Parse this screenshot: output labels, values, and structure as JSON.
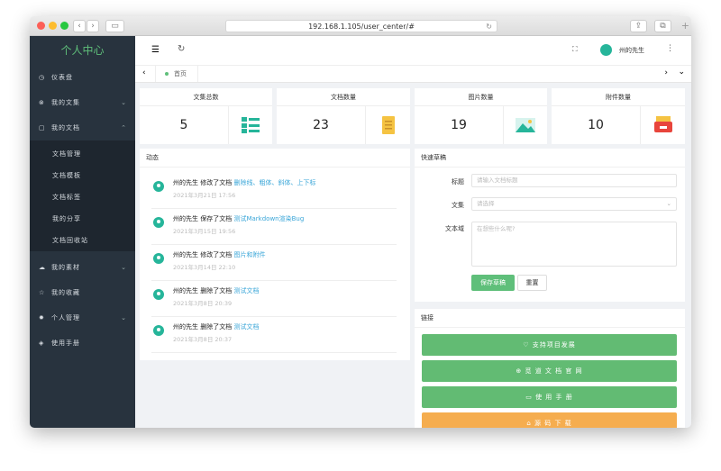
{
  "browser": {
    "url": "192.168.1.105/user_center/#"
  },
  "sidebar": {
    "title": "个人中心",
    "items": [
      {
        "label": "仪表盘",
        "icon": "dashboard-icon"
      },
      {
        "label": "我的文集",
        "icon": "collection-icon",
        "chevron": "down"
      },
      {
        "label": "我的文档",
        "icon": "document-icon",
        "chevron": "up"
      },
      {
        "label": "我的素材",
        "icon": "material-icon",
        "chevron": "down"
      },
      {
        "label": "我的收藏",
        "icon": "star-icon"
      },
      {
        "label": "个人管理",
        "icon": "gear-icon",
        "chevron": "down"
      },
      {
        "label": "使用手册",
        "icon": "book-icon"
      }
    ],
    "subitems": [
      "文档管理",
      "文档模板",
      "文档标签",
      "我的分享",
      "文档回收站"
    ]
  },
  "header": {
    "username": "州的先生"
  },
  "tabs": [
    {
      "label": "首页"
    }
  ],
  "stats": [
    {
      "label": "文集总数",
      "value": "5",
      "icon": "list-icon",
      "color": "#26b59a"
    },
    {
      "label": "文档数量",
      "value": "23",
      "icon": "document-icon",
      "color": "#f5c342"
    },
    {
      "label": "图片数量",
      "value": "19",
      "icon": "image-icon",
      "color": "#26b59a"
    },
    {
      "label": "附件数量",
      "value": "10",
      "icon": "attachment-icon",
      "color": "#e8453c"
    }
  ],
  "activity": {
    "title": "动态",
    "items": [
      {
        "user": "州的先生",
        "action": "修改了文档",
        "doc": "删除线、粗体、斜体、上下标",
        "time": "2021年3月21日 17:56"
      },
      {
        "user": "州的先生",
        "action": "保存了文档",
        "doc": "测试Markdown渲染Bug",
        "time": "2021年3月15日 19:56"
      },
      {
        "user": "州的先生",
        "action": "修改了文档",
        "doc": "图片和附件",
        "time": "2021年3月14日 22:10"
      },
      {
        "user": "州的先生",
        "action": "删除了文档",
        "doc": "测试文档",
        "time": "2021年3月8日 20:39"
      },
      {
        "user": "州的先生",
        "action": "删除了文档",
        "doc": "测试文档",
        "time": "2021年3月8日 20:37"
      }
    ]
  },
  "draft": {
    "title": "快速草稿",
    "title_label": "标题",
    "title_placeholder": "请输入文档标题",
    "collection_label": "文集",
    "collection_placeholder": "请选择",
    "text_label": "文本域",
    "text_placeholder": "在想些什么呢?",
    "save": "保存草稿",
    "reset": "重置"
  },
  "links": {
    "title": "链接",
    "items": [
      {
        "label": "♡ 支持项目发展",
        "color": "#62bb73"
      },
      {
        "label": "⊕ 觅 道 文 档 官 网",
        "color": "#62bb73"
      },
      {
        "label": "▭ 使 用 手 册",
        "color": "#62bb73"
      },
      {
        "label": "⌂ 源 码 下 载",
        "color": "#f5ad4f"
      }
    ]
  }
}
